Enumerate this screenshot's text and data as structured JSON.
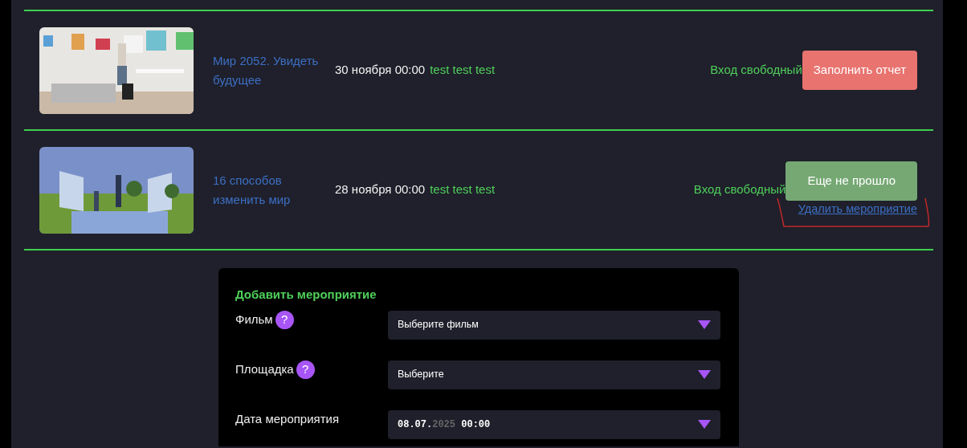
{
  "events": [
    {
      "title": "Мир 2052. Увидеть будущее",
      "date": "30 ноября 00:00",
      "tags": "test test test",
      "entry": "Вход свободный",
      "action": {
        "kind": "report",
        "label": "Заполнить отчет"
      }
    },
    {
      "title": "16 способов изменить мир",
      "date": "28 ноября 00:00",
      "tags": "test test test",
      "entry": "Вход свободный",
      "action": {
        "kind": "pending",
        "label": "Еще не прошло"
      },
      "delete_link": "Удалить мероприятие"
    }
  ],
  "form": {
    "title": "Добавить мероприятие",
    "fields": [
      {
        "kind": "select",
        "label": "Фильм",
        "help": "?",
        "placeholder": "Выберите фильм"
      },
      {
        "kind": "select",
        "label": "Площадка",
        "help": "?",
        "placeholder": "Выберите"
      },
      {
        "kind": "datetime",
        "label": "Дата мероприятия",
        "value_parts": [
          {
            "text": "08.07.",
            "dim": false
          },
          {
            "text": "2025",
            "dim": true
          },
          {
            "text": "00:00",
            "dim": false
          }
        ]
      }
    ]
  }
}
